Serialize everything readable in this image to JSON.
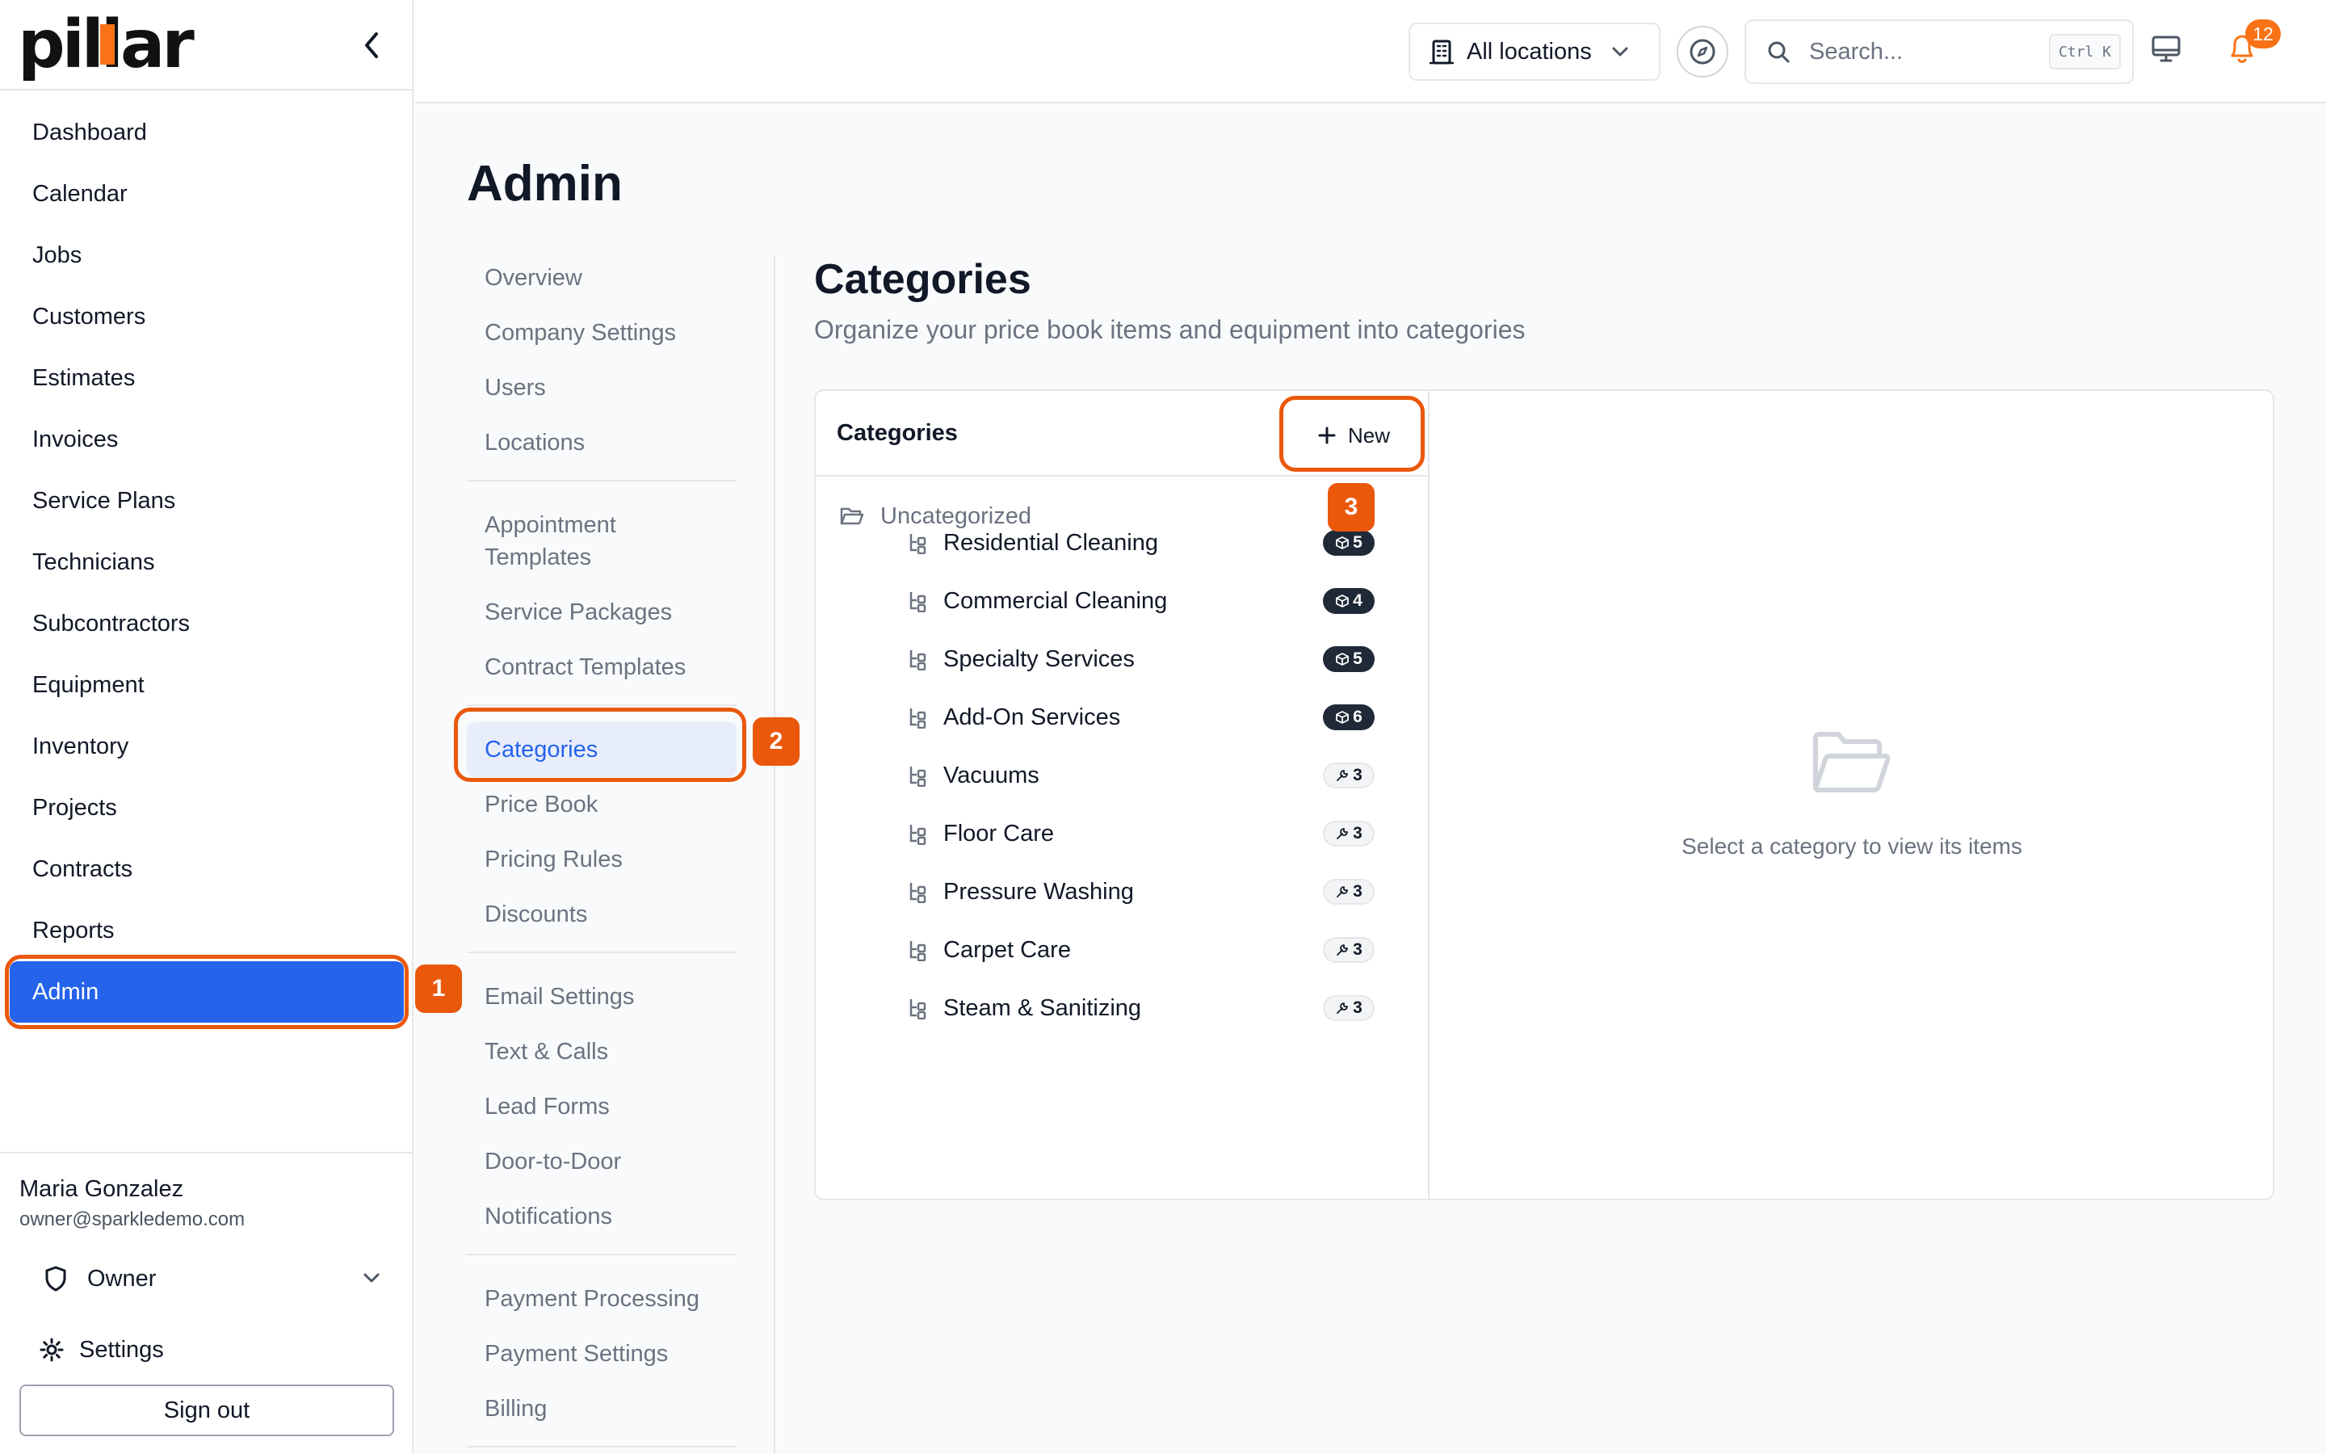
{
  "app": {
    "logo_text": "pillar"
  },
  "sidebar": {
    "items": [
      {
        "label": "Dashboard"
      },
      {
        "label": "Calendar"
      },
      {
        "label": "Jobs"
      },
      {
        "label": "Customers"
      },
      {
        "label": "Estimates"
      },
      {
        "label": "Invoices"
      },
      {
        "label": "Service Plans"
      },
      {
        "label": "Technicians"
      },
      {
        "label": "Subcontractors"
      },
      {
        "label": "Equipment"
      },
      {
        "label": "Inventory"
      },
      {
        "label": "Projects"
      },
      {
        "label": "Contracts"
      },
      {
        "label": "Reports"
      },
      {
        "label": "Admin"
      }
    ],
    "active": "Admin",
    "user": {
      "name": "Maria Gonzalez",
      "email": "owner@sparkledemo.com",
      "role": "Owner",
      "settings_label": "Settings",
      "signout_label": "Sign out"
    }
  },
  "header": {
    "location_label": "All locations",
    "search_placeholder": "Search...",
    "search_shortcut": "Ctrl K",
    "notification_count": "12"
  },
  "page": {
    "title": "Admin",
    "subnav": [
      {
        "label": "Overview"
      },
      {
        "label": "Company Settings"
      },
      {
        "label": "Users"
      },
      {
        "label": "Locations"
      },
      {
        "label": "Appointment Templates"
      },
      {
        "label": "Service Packages"
      },
      {
        "label": "Contract Templates"
      },
      {
        "label": "Categories"
      },
      {
        "label": "Price Book"
      },
      {
        "label": "Pricing Rules"
      },
      {
        "label": "Discounts"
      },
      {
        "label": "Email Settings"
      },
      {
        "label": "Text & Calls"
      },
      {
        "label": "Lead Forms"
      },
      {
        "label": "Door-to-Door"
      },
      {
        "label": "Notifications"
      },
      {
        "label": "Payment Processing"
      },
      {
        "label": "Payment Settings"
      },
      {
        "label": "Billing"
      }
    ],
    "active_subnav": "Categories"
  },
  "categories": {
    "title": "Categories",
    "subtitle": "Organize your price book items and equipment into categories",
    "list_title": "Categories",
    "new_label": "New",
    "uncategorized_label": "Uncategorized",
    "items": [
      {
        "name": "Residential Cleaning",
        "count": "5",
        "kind": "items"
      },
      {
        "name": "Commercial Cleaning",
        "count": "4",
        "kind": "items"
      },
      {
        "name": "Specialty Services",
        "count": "5",
        "kind": "items"
      },
      {
        "name": "Add-On Services",
        "count": "6",
        "kind": "items"
      },
      {
        "name": "Vacuums",
        "count": "3",
        "kind": "equipment"
      },
      {
        "name": "Floor Care",
        "count": "3",
        "kind": "equipment"
      },
      {
        "name": "Pressure Washing",
        "count": "3",
        "kind": "equipment"
      },
      {
        "name": "Carpet Care",
        "count": "3",
        "kind": "equipment"
      },
      {
        "name": "Steam & Sanitizing",
        "count": "3",
        "kind": "equipment"
      }
    ],
    "empty_text": "Select a category to view its items"
  },
  "annotations": [
    "1",
    "2",
    "3"
  ],
  "colors": {
    "accent": "#2563eb",
    "annotation": "#ea580c",
    "brand": "#f97316"
  }
}
